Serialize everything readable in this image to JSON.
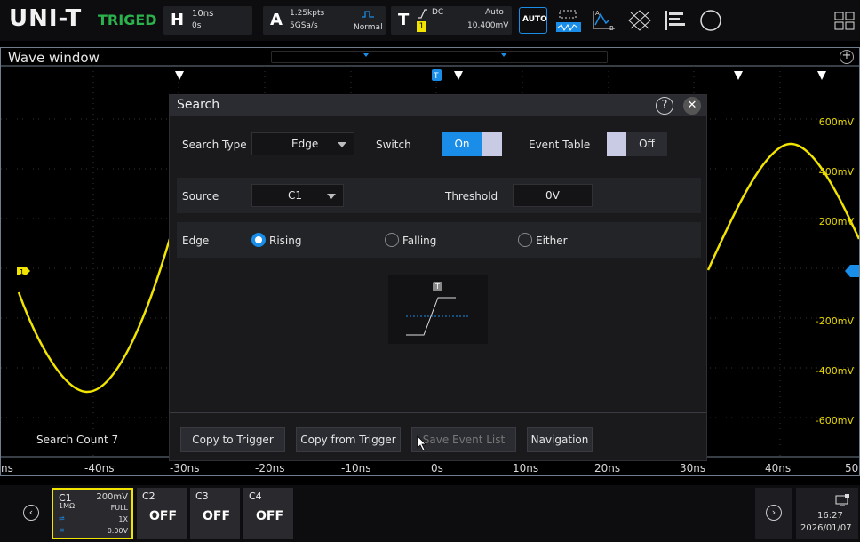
{
  "top_bar": {
    "logo": "UNI-T",
    "trigger_state": "TRIGED",
    "horizontal": {
      "letter": "H",
      "timebase": "10ns",
      "position": "0s"
    },
    "acquire": {
      "letter": "A",
      "points": "1.25kpts",
      "rate": "5GSa/s",
      "mode": "Normal"
    },
    "trigger": {
      "letter": "T",
      "coupling": "DC",
      "mode": "Auto",
      "source": "1",
      "level": "10.400mV"
    },
    "auto_label": "AUTO",
    "tool_icons": [
      "auto-button-icon",
      "measure-icon",
      "cursor-icon",
      "math-icon",
      "display-icon",
      "record-icon",
      "layout-grid-icon"
    ]
  },
  "wave_window": {
    "title": "Wave window",
    "y_labels": [
      "600mV",
      "400mV",
      "200mV",
      "-200mV",
      "-400mV",
      "-600mV"
    ],
    "x_labels": [
      "ns",
      "-40ns",
      "-30ns",
      "-20ns",
      "-10ns",
      "0s",
      "10ns",
      "20ns",
      "30ns",
      "40ns",
      "50"
    ],
    "search_count": "Search Count 7",
    "channel_marker": "1",
    "trigger_marker": "T",
    "trace_color": "#f0e400"
  },
  "dialog": {
    "title": "Search",
    "search_type_label": "Search Type",
    "search_type_value": "Edge",
    "switch_label": "Switch",
    "switch_value": "On",
    "event_table_label": "Event Table",
    "event_table_value": "Off",
    "source_label": "Source",
    "source_value": "C1",
    "threshold_label": "Threshold",
    "threshold_value": "0V",
    "edge_label": "Edge",
    "edge_options": [
      "Rising",
      "Falling",
      "Either"
    ],
    "edge_selected": "Rising",
    "diagram_marker": "T",
    "buttons": {
      "copy_to_trigger": "Copy to Trigger",
      "copy_from_trigger": "Copy from Trigger",
      "save_event_list": "Save Event List",
      "navigation": "Navigation"
    },
    "accent": "#1a8de8"
  },
  "bottom_bar": {
    "channels": [
      {
        "name": "C1",
        "scale": "200mV",
        "impedance": "1MΩ",
        "bandwidth": "FULL",
        "probe": "1X",
        "offset": "0.00V",
        "color": "#f0e400"
      },
      {
        "name": "C2",
        "state": "OFF"
      },
      {
        "name": "C3",
        "state": "OFF"
      },
      {
        "name": "C4",
        "state": "OFF"
      }
    ],
    "time": "16:27",
    "date": "2026/01/07"
  }
}
